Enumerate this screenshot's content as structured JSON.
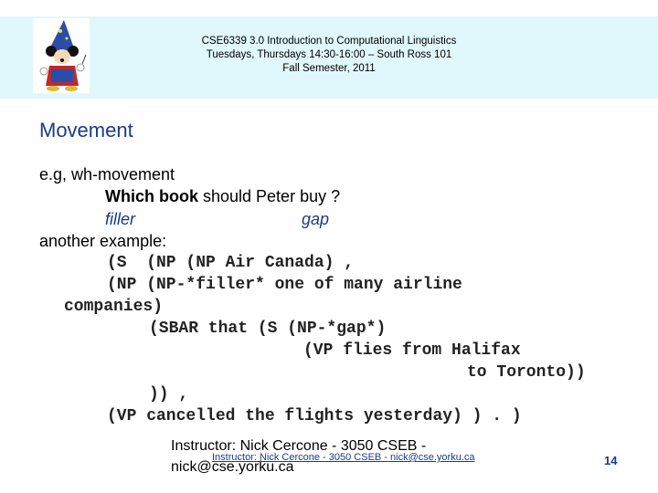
{
  "header": {
    "logo_icon": "wizard-mouse-logo",
    "lines": [
      "CSE6339 3.0 Introduction to Computational Linguistics",
      "Tuesdays, Thursdays 14:30-16:00 – South Ross 101",
      "Fall Semester, 2011"
    ]
  },
  "slide": {
    "title": "Movement",
    "intro": "e.g, wh-movement",
    "example_bold": "Which book",
    "example_rest": " should Peter buy ?",
    "filler_label": "filler",
    "gap_label": "gap",
    "another": "another example:",
    "code_lines": [
      "(S  (NP (NP Air Canada) ,",
      "(NP (NP-*filler* one of many airline",
      "companies)",
      "(SBAR that (S (NP-*gap*)",
      "(VP flies from Halifax",
      "to Toronto))",
      ")) ,",
      "(VP cancelled the flights yesterday) ) . )"
    ]
  },
  "footer": {
    "instructor_line1": "Instructor: Nick Cercone - 3050 CSEB -",
    "instructor_line2": "nick@cse.yorku.ca",
    "instructor_small": "Instructor: Nick Cercone - 3050 CSEB - nick@cse.yorku.ca",
    "page_number": "14"
  }
}
